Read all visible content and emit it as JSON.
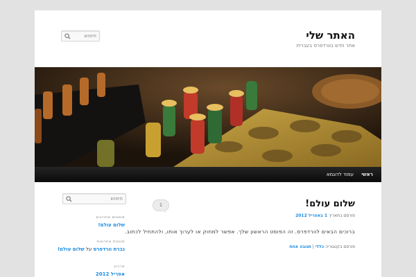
{
  "site": {
    "title": "האתר שלי",
    "description": "אתר חדש בוורדפרס בעברית"
  },
  "header_search": {
    "placeholder": "חיפוש",
    "icon": "search-icon"
  },
  "nav": {
    "items": [
      {
        "label": "ראשי"
      },
      {
        "label": "עמוד לדוגמא"
      }
    ]
  },
  "post": {
    "title": "שלום עולם!",
    "meta_prefix": "פורסם בתאריך",
    "date": "1 באפריל 2012",
    "content": "ברוכים הבאים לוורדפרס. זה הפוסט הראשון שלך. אפשר למחוק או לערוך אותו, ולהתחיל לכתוב.",
    "footer_prefix": "פורסם בקטגוריה",
    "category": "כללי",
    "separator": "|",
    "reply_link": "תגובה אחת",
    "comment_count": "1"
  },
  "sidebar": {
    "search_placeholder": "חיפוש",
    "recent_posts_title": "פוסטים אחרונים",
    "recent_posts": [
      "שלום עולם!"
    ],
    "recent_comments_title": "תגובות אחרונות",
    "recent_comment": {
      "author": "גברת וורדפרס",
      "on": "על",
      "post": "שלום עולם!"
    },
    "archives_title": "ארכיון",
    "archives": [
      "אפריל 2012"
    ]
  },
  "colors": {
    "link": "#1b8be0",
    "nav_bg": "#111111",
    "page_bg": "#e2e2e2"
  }
}
